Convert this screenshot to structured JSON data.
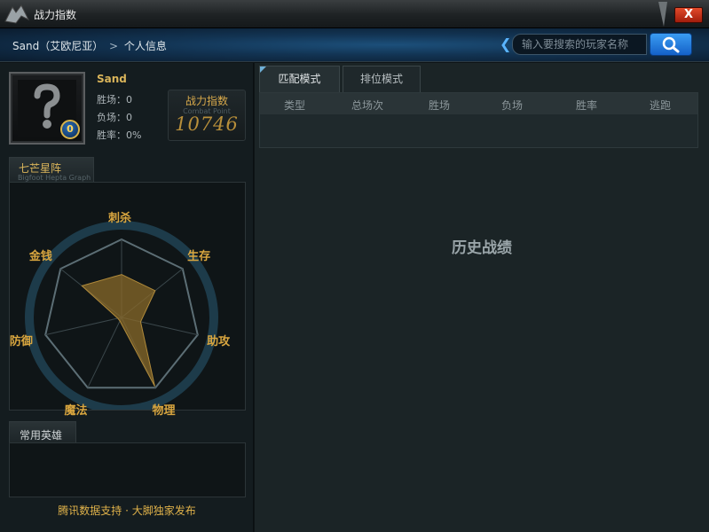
{
  "window": {
    "title": "战力指数",
    "close_label": "X"
  },
  "header": {
    "breadcrumb_player": "Sand（艾欧尼亚）",
    "breadcrumb_separator": ">",
    "breadcrumb_page": "个人信息",
    "search_placeholder": "输入要搜索的玩家名称"
  },
  "profile": {
    "name": "Sand",
    "level": "0",
    "wins_label": "胜场：0",
    "losses_label": "负场：0",
    "winrate_label": "胜率：0%"
  },
  "combat_point": {
    "title": "战力指数",
    "subtitle": "Combat Point",
    "value": "10746"
  },
  "hepta": {
    "title": "七芒星阵",
    "subtitle": "Bigfoot Hepta Graph",
    "axes": [
      "刺杀",
      "生存",
      "助攻",
      "物理",
      "魔法",
      "防御",
      "金钱"
    ],
    "levels": [
      0.55,
      0.55,
      0.25,
      0.98,
      0.05,
      0.05,
      0.65
    ],
    "fill_color": "#8a6a2a",
    "label_color": "#d9a63f"
  },
  "heroes": {
    "title": "常用英雄"
  },
  "footer_note": "腾讯数据支持 · 大脚独家发布",
  "history": {
    "tabs": [
      "匹配模式",
      "排位模式"
    ],
    "columns": [
      "类型",
      "总场次",
      "胜场",
      "负场",
      "胜率",
      "逃跑"
    ],
    "empty_text": "历史战绩"
  }
}
